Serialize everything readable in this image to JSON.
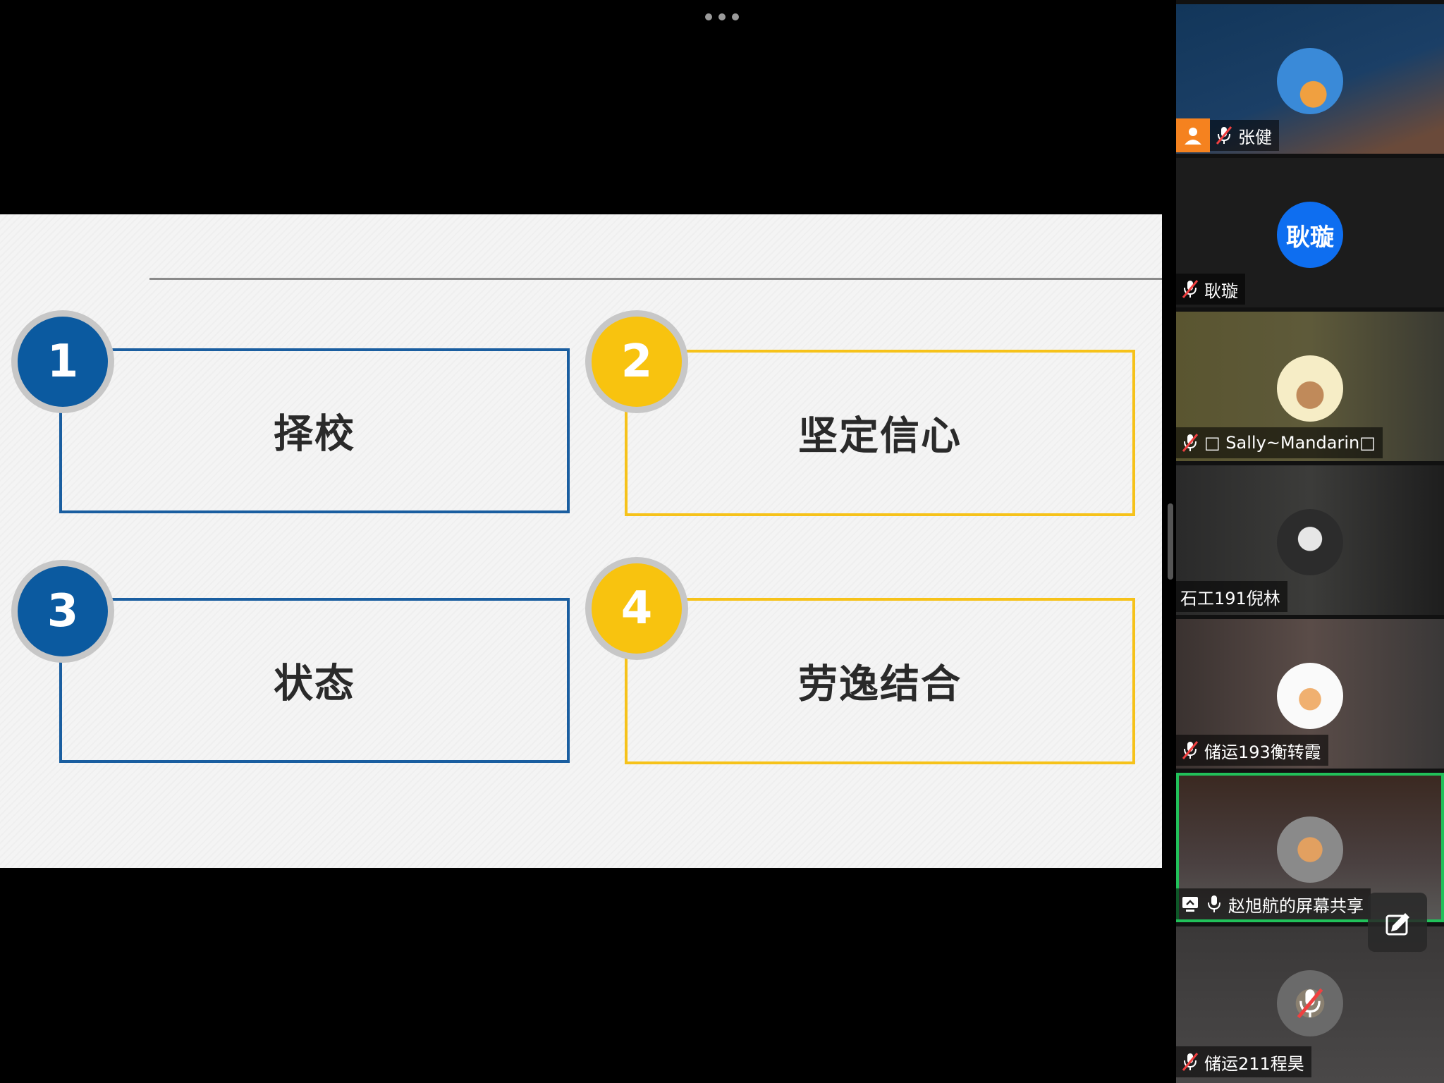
{
  "slide": {
    "items": [
      {
        "number": "1",
        "label": "择校",
        "color": "blue"
      },
      {
        "number": "2",
        "label": "坚定信心",
        "color": "yellow"
      },
      {
        "number": "3",
        "label": "状态",
        "color": "blue"
      },
      {
        "number": "4",
        "label": "劳逸结合",
        "color": "yellow"
      }
    ]
  },
  "colors": {
    "blue": "#0b5aa0",
    "yellow": "#f8c30f",
    "active_speaker": "#21c15a",
    "host": "#f5821f"
  },
  "participants": [
    {
      "name": "张健",
      "avatar": "cloud-sky-avatar",
      "muted": true,
      "host": true
    },
    {
      "name": "耿璇",
      "avatar_text": "耿璇",
      "muted": true
    },
    {
      "name": "□ Sally~Mandarin□",
      "avatar": "cartoon-character-avatar",
      "muted": true
    },
    {
      "name": "石工191倪林",
      "avatar": "monster-sticker-avatar",
      "muted": false
    },
    {
      "name": "储运193衡转霞",
      "avatar": "cat-cartoon-avatar",
      "muted": true
    },
    {
      "name": "赵旭航的屏幕共享",
      "avatar": "corgi-avatar",
      "muted": false,
      "sharing": true,
      "active": true
    },
    {
      "name": "储运211程昊",
      "avatar": "landscape-avatar",
      "muted": true
    }
  ]
}
